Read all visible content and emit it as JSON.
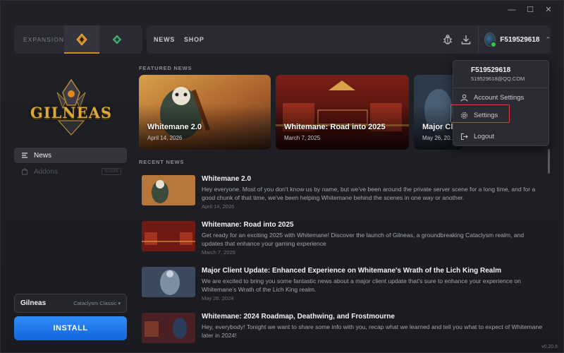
{
  "window": {
    "minimize": "—",
    "maximize": "☐",
    "close": "✕"
  },
  "topbar": {
    "expansions_label": "EXPANSIONS",
    "nav": [
      "NEWS",
      "SHOP"
    ],
    "user": {
      "name": "F519529618"
    }
  },
  "sidebar": {
    "logo_text": "GILNEAS",
    "items": [
      {
        "label": "News",
        "icon": "list-icon"
      },
      {
        "label": "Addons",
        "icon": "box-icon",
        "badge": "SOON"
      }
    ],
    "realm": {
      "name": "Gilneas",
      "expansion": "Cataclysm Classic"
    },
    "install_label": "INSTALL"
  },
  "featured": {
    "label": "FEATURED NEWS",
    "cards": [
      {
        "title": "Whitemane 2.0",
        "date": "April 14, 2026"
      },
      {
        "title": "Whitemane: Road into 2025",
        "date": "March 7, 2025"
      },
      {
        "title": "Major Cl...",
        "date": "May 26, 20..."
      }
    ]
  },
  "recent": {
    "label": "RECENT NEWS",
    "items": [
      {
        "title": "Whitemane 2.0",
        "body": "Hey everyone. Most of you don't know us by name, but we've been around the private server scene for a long time, and for a good chunk of that time, we've been helping Whitemane behind the scenes in one way or another.",
        "date": "April 14, 2026"
      },
      {
        "title": "Whitemane: Road into 2025",
        "body": "Get ready for an exciting 2025 with Whitemane! Discover the launch of Gilneas, a groundbreaking Cataclysm realm, and updates that enhance your gaming experience",
        "date": "March 7, 2025"
      },
      {
        "title": "Major Client Update: Enhanced Experience on Whitemane's Wrath of the Lich King Realm",
        "body": "We are excited to bring you some fantastic news about a major client update that's sure to enhance your experience on Whitemane's Wrath of the Lich King realm.",
        "date": "May 26, 2024"
      },
      {
        "title": "Whitemane: 2024 Roadmap, Deathwing, and Frostmourne",
        "body": "Hey, everybody! Tonight we want to share some info with you, recap what we learned and tell you what to expect of Whitemane later in 2024!",
        "date": ""
      }
    ]
  },
  "dropdown": {
    "name": "F519529618",
    "email": "519529618@QQ.COM",
    "items": [
      {
        "label": "Account Settings",
        "icon": "user-icon"
      },
      {
        "label": "Settings",
        "icon": "gear-icon"
      },
      {
        "label": "Logout",
        "icon": "logout-icon"
      }
    ]
  },
  "version": "v0.20.8",
  "colors": {
    "accent": "#1f78ea",
    "active_expansion": "#d08a24",
    "highlight": "#e53935"
  }
}
